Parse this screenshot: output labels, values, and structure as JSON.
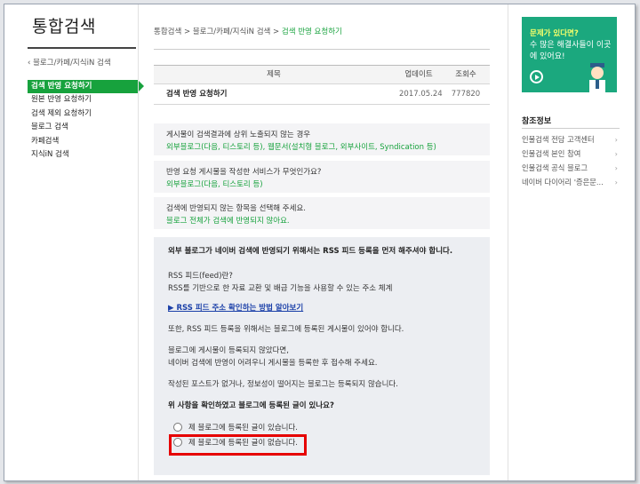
{
  "logo": "통합검색",
  "left_crumb": "블로그/카페/지식iN 검색",
  "left_nav": [
    {
      "label": "검색 반영 요청하기",
      "active": true
    },
    {
      "label": "원본 반영 요청하기"
    },
    {
      "label": "검색 제외 요청하기"
    },
    {
      "label": "블로그 검색"
    },
    {
      "label": "카페검색"
    },
    {
      "label": "지식iN 검색"
    }
  ],
  "breadcrumb": {
    "items": [
      "통합검색",
      "블로그/카페/지식iN 검색"
    ],
    "current": "검색 반영 요청하기",
    "separator": ">"
  },
  "table": {
    "headers": {
      "title": "제목",
      "date": "업데이트",
      "views": "조회수"
    },
    "row": {
      "title": "검색 반영 요청하기",
      "date": "2017.05.24",
      "views": "777820"
    }
  },
  "qa": [
    {
      "q": "게시물이 검색결과에 상위 노출되지 않는 경우",
      "a": "외부블로그(다음, 티스토리 등), 웹문서(설치형 블로그, 외부사이트, Syndication 등)"
    },
    {
      "q": "반영 요청 게시물을 작성한 서비스가 무엇인가요?",
      "a": "외부블로그(다음, 티스토리 등)"
    },
    {
      "q": "검색에 반영되지 않는 항목을 선택해 주세요.",
      "a": "블로그 전체가 검색에 반영되지 않아요."
    }
  ],
  "panel": {
    "title": "외부 블로그가 네이버 검색에 반영되기 위해서는 RSS 피드 등록을 먼저 해주셔야 합니다.",
    "rss_q": "RSS 피드(feed)란?",
    "rss_def": "RSS를 기반으로 한 자료 교환 및 배급 기능을 사용할 수 있는 주소 체계",
    "link": "▶ RSS 피드 주소 확인하는 방법 알아보기",
    "p1": "또한, RSS 피드 등록을 위해서는 블로그에 등록된 게시물이 있어야 합니다.",
    "p2a": "블로그에 게시물이 등록되지 않았다면,",
    "p2b": "네이버 검색에 반영이 어려우니 게시물을 등록한 후 접수해 주세요.",
    "p3": "작성된 포스트가 없거나, 정보성이 떨어지는 블로그는 등록되지 않습니다.",
    "question": "위 사항을 확인하였고 블로그에 등록된 글이 있나요?",
    "options": [
      "제 블로그에 등록된 글이 있습니다.",
      "제 블로그에 등록된 글이 없습니다."
    ]
  },
  "banner": {
    "line1": "문제가 있다면?",
    "line2": "수 많은 해결사들이 이곳에 있어요!"
  },
  "reference": {
    "title": "참조정보",
    "items": [
      "인물검색 전담 고객센터",
      "인물검색 본인 참여",
      "인물검색 공식 블로그",
      "네이버 다이어리 '증은문..."
    ]
  },
  "colors": {
    "accent": "#17a23d",
    "highlight": "#e60000",
    "banner": "#1ba87e"
  }
}
